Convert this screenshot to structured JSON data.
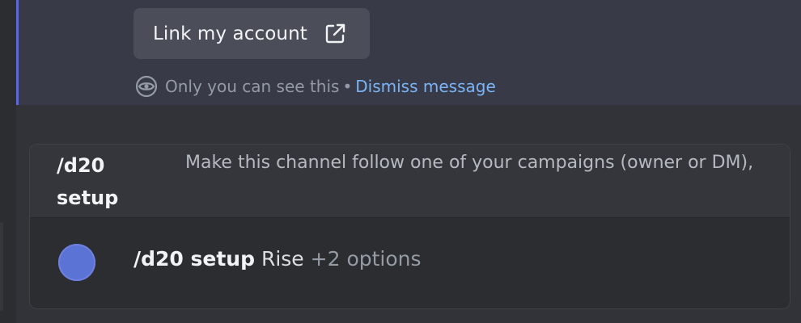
{
  "message": {
    "link_button_label": "Link my account",
    "visibility_text": "Only you can see this",
    "separator": "•",
    "dismiss_label": "Dismiss message"
  },
  "autocomplete": {
    "command_name": "/d20 setup",
    "command_description": "Make this channel follow one of your campaigns (owner or DM),",
    "option": {
      "command": "/d20 setup",
      "argument": "Rise",
      "extra_options": "+2 options"
    }
  },
  "colors": {
    "accent": "#5865f2",
    "link": "#7bb4f5",
    "avatar": "#5b73d4"
  },
  "icons": {
    "external_link": "external-link-icon",
    "eye": "eye-icon"
  }
}
